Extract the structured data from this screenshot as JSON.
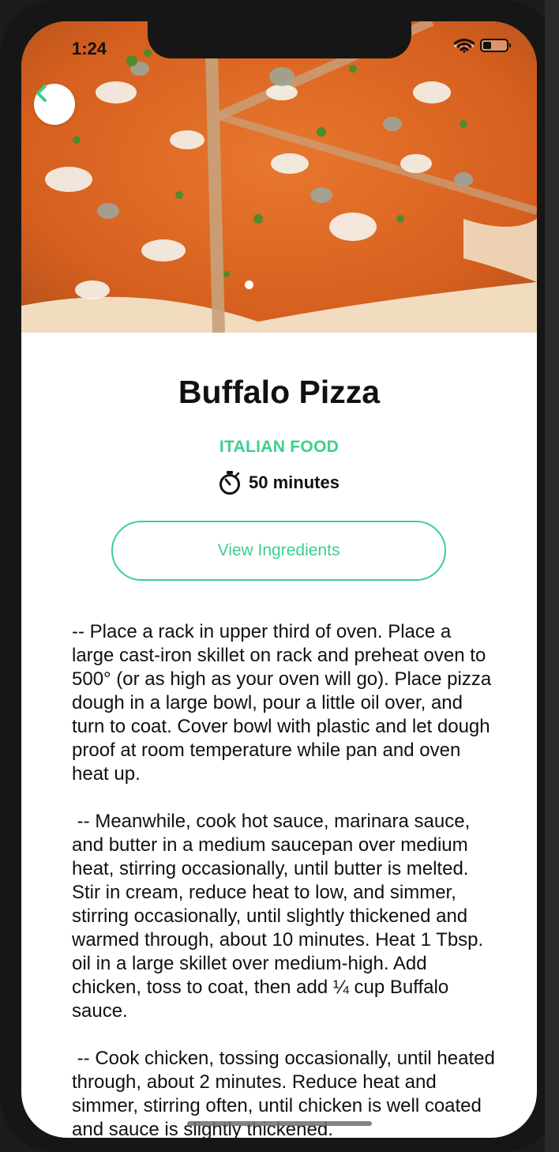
{
  "status_bar": {
    "time": "1:24",
    "icons": [
      "signal-dots-icon",
      "wifi-icon",
      "battery-icon"
    ]
  },
  "hero": {
    "back_icon": "chevron-left-icon",
    "page_indicator": {
      "count": 1,
      "active_index": 0
    }
  },
  "recipe": {
    "title": "Buffalo Pizza",
    "category": "ITALIAN FOOD",
    "time_icon": "stopwatch-icon",
    "time": "50 minutes",
    "ingredients_button": "View Ingredients",
    "instructions": "-- Place a rack in upper third of oven. Place a large cast-iron skillet on rack and preheat oven to 500° (or as high as your oven will go). Place pizza dough in a large bowl, pour a little oil over, and turn to coat. Cover bowl with plastic and let dough proof at room temperature while pan and oven heat up.\n\n -- Meanwhile, cook hot sauce, marinara sauce, and butter in a medium saucepan over medium heat, stirring occasionally, until butter is melted. Stir in cream, reduce heat to low, and simmer, stirring occasionally, until slightly thickened and warmed through, about 10 minutes. Heat 1 Tbsp. oil in a large skillet over medium-high. Add chicken, toss to coat, then add ¼ cup Buffalo sauce.\n\n -- Cook chicken, tossing occasionally, until heated through, about 2 minutes. Reduce heat and simmer, stirring often, until chicken is well coated and sauce is slightly thickened."
  },
  "colors": {
    "accent": "#3ccf8e",
    "text": "#111111",
    "background": "#ffffff"
  }
}
